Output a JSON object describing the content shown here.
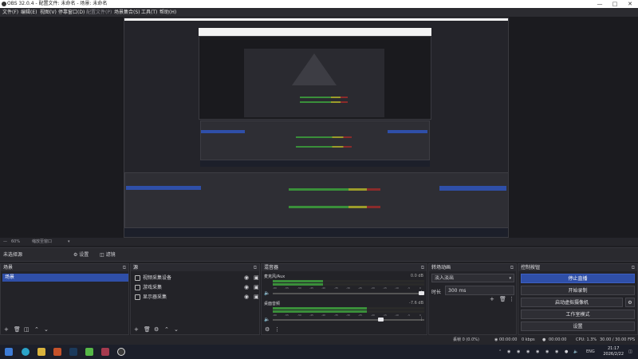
{
  "window": {
    "title": "OBS 32.0.4 - 配置文件: 未命名 - 场景: 未命名",
    "controls": [
      "minimize-icon",
      "maximize-icon",
      "close-icon"
    ]
  },
  "menu": {
    "items": [
      {
        "label": "文件(F)",
        "enabled": true
      },
      {
        "label": "编辑(E)",
        "enabled": true
      },
      {
        "label": "视图(V)",
        "enabled": true
      },
      {
        "label": "停靠窗口(D)",
        "enabled": true
      },
      {
        "label": "配置文件(P)",
        "enabled": false
      },
      {
        "label": "场景集合(S)",
        "enabled": true
      },
      {
        "label": "工具(T)",
        "enabled": true
      },
      {
        "label": "帮助(H)",
        "enabled": true
      }
    ]
  },
  "preview": {
    "scale_label": "60%",
    "scale_mode": "缩放至窗口"
  },
  "scene_bar": {
    "label": "未选择源",
    "props_label": "设置",
    "filters_label": "滤镜"
  },
  "docks": {
    "scenes": {
      "title": "场景",
      "items": [
        "场景"
      ]
    },
    "sources": {
      "title": "源",
      "items": [
        {
          "label": "视频采集设备",
          "icon": "camera-icon"
        },
        {
          "label": "游戏采集",
          "icon": "gamepad-icon"
        },
        {
          "label": "显示器采集",
          "icon": "monitor-icon"
        }
      ]
    },
    "mixer": {
      "title": "混音器",
      "channels": [
        {
          "name": "麦克风/Aux",
          "db": "0.0 dB",
          "level": 0.33,
          "volume": 1.0
        },
        {
          "name": "桌面音频",
          "db": "-7.6 dB",
          "level": 0.62,
          "volume": 0.72
        }
      ],
      "ticks": [
        "-60",
        "-55",
        "-50",
        "-45",
        "-40",
        "-35",
        "-30",
        "-25",
        "-20",
        "-15",
        "-10",
        "-5",
        "0"
      ]
    },
    "transitions": {
      "title": "转场动画",
      "selected": "淡入淡出",
      "duration_label": "时长",
      "duration_value": "300 ms"
    },
    "controls": {
      "title": "控制按钮",
      "buttons": [
        "停止直播",
        "开始录制",
        "启动虚拟摄像机",
        "工作室模式",
        "设置"
      ]
    }
  },
  "status": {
    "dropped": "丢帧 0 (0.0%)",
    "rec_time": "00:00:00",
    "kbps": "0 kbps",
    "stream_time": "00:00:00",
    "cpu": "CPU: 1.3%",
    "fps": "30.00 / 30.00 FPS"
  },
  "taskbar": {
    "apps": [
      "windows-icon",
      "edge-icon",
      "explorer-icon",
      "office-icon",
      "steam-icon",
      "xbox-icon",
      "game-icon",
      "obs-icon"
    ],
    "lang": "ENG",
    "time": "21:17",
    "date": "2026/2/22"
  },
  "colors": {
    "accent": "#2f4fa8",
    "background": "#1f1f23",
    "meter_green": "#3a8f3a",
    "meter_yellow": "#9c9c2a",
    "meter_red": "#8a2b2b"
  }
}
